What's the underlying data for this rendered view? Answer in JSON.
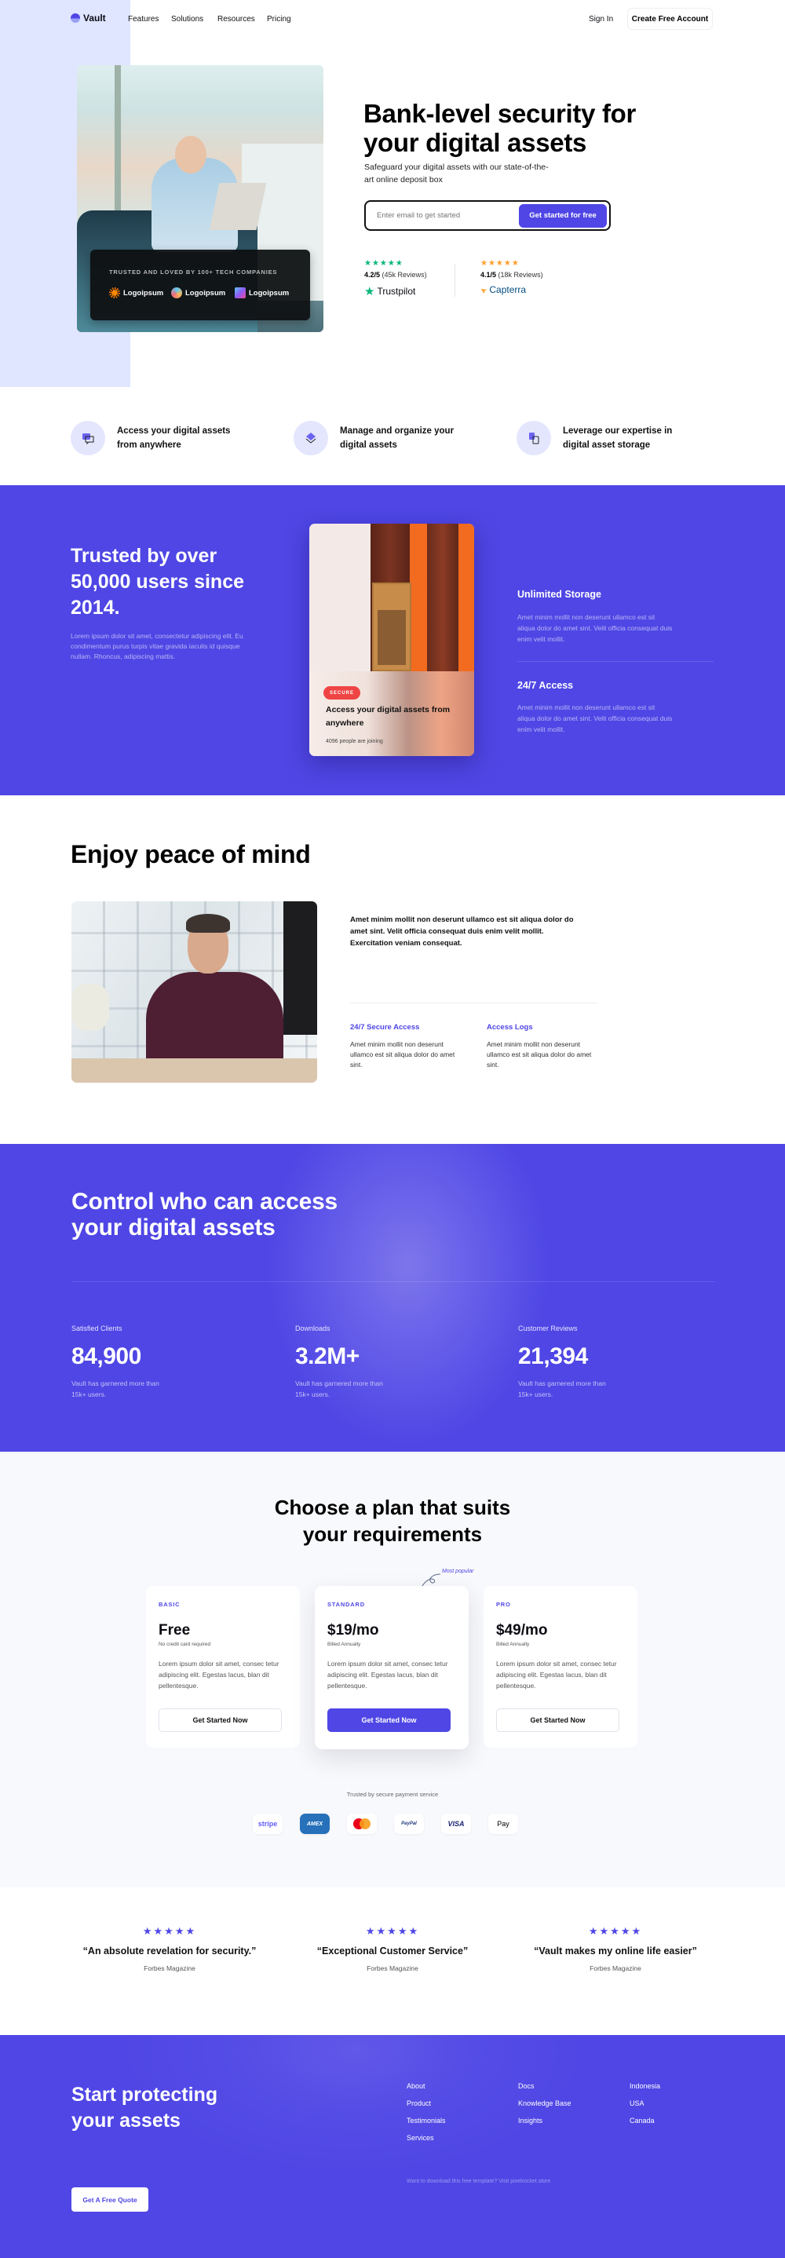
{
  "nav": {
    "brand": "Vault",
    "links": [
      "Features",
      "Solutions",
      "Resources",
      "Pricing"
    ],
    "sign_in": "Sign In",
    "cta": "Create Free Account"
  },
  "hero": {
    "title": "Bank-level security for your digital assets",
    "subtitle": "Safeguard your digital assets with our state-of-the-art online deposit box",
    "email_placeholder": "Enter email to get started",
    "email_button": "Get started for free",
    "trust_title": "TRUSTED AND LOVED BY 100+ TECH COMPANIES",
    "trust_logos": [
      "Logoipsum",
      "Logoipsum",
      "Logoipsum"
    ],
    "ratings": [
      {
        "stars": "★★★★★",
        "score": "4.2/5",
        "reviews": "(45k Reviews)",
        "brand": "Trustpilot",
        "brand_icon": "★",
        "color": "#00b67a"
      },
      {
        "stars": "★★★★★",
        "score": "4.1/5",
        "reviews": "(18k Reviews)",
        "brand": "Capterra",
        "brand_icon": "➤",
        "color": "#ff9d28"
      }
    ]
  },
  "features": [
    {
      "icon": "chat-icon",
      "glyph": "💬",
      "text": "Access your digital assets from anywhere"
    },
    {
      "icon": "layers-icon",
      "glyph": "◈",
      "text": "Manage and organize your digital assets"
    },
    {
      "icon": "sync-icon",
      "glyph": "⇄",
      "text": "Leverage our expertise in digital asset storage"
    }
  ],
  "trusted": {
    "title": "Trusted by over 50,000 users since 2014.",
    "body": "Lorem ipsum dolor sit amet, consectetur adipiscing elit. Eu condimentum purus turpis vitae gravida iaculis id quisque nullam. Rhoncus, adipiscing mattis.",
    "card": {
      "badge": "SECURE",
      "title": "Access your digital assets from anywhere",
      "sub": "4096 people are joining"
    },
    "items": [
      {
        "title": "Unlimited Storage",
        "body": "Amet minim mollit non deserunt ullamco est sit aliqua dolor do amet sint. Velit officia consequat duis enim velit mollit."
      },
      {
        "title": "24/7 Access",
        "body": "Amet minim mollit non deserunt ullamco est sit aliqua dolor do amet sint. Velit officia consequat duis enim velit mollit."
      }
    ]
  },
  "peace": {
    "title": "Enjoy peace of mind",
    "lead": "Amet minim mollit non deserunt ullamco est sit aliqua dolor do amet sint. Velit officia consequat duis enim velit mollit. Exercitation veniam consequat.",
    "cols": [
      {
        "title": "24/7 Secure Access",
        "body": "Amet minim mollit non deserunt ullamco est sit aliqua dolor do amet sint."
      },
      {
        "title": "Access Logs",
        "body": "Amet minim mollit non deserunt ullamco est sit aliqua dolor do amet sint."
      }
    ]
  },
  "control": {
    "title_l1": "Control who can access",
    "title_l2": "your digital assets",
    "stats": [
      {
        "label": "Satisfied Clients",
        "value": "84,900",
        "desc": "Vault has garnered more than 15k+ users."
      },
      {
        "label": "Downloads",
        "value": "3.2M+",
        "desc": "Vault has garnered more than 15k+ users."
      },
      {
        "label": "Customer Reviews",
        "value": "21,394",
        "desc": "Vault has garnered more than 15k+ users."
      }
    ]
  },
  "pricing": {
    "title_l1": "Choose a plan that suits",
    "title_l2": "your requirements",
    "most_popular": "Most popular",
    "plans": [
      {
        "tier": "BASIC",
        "price": "Free",
        "note": "No credit card required",
        "desc": "Lorem ipsum dolor sit amet, consec tetur adipiscing elit. Egestas lacus, blan dit pellentesque.",
        "button": "Get Started Now"
      },
      {
        "tier": "STANDARD",
        "price": "$19/mo",
        "note": "Billed Annually",
        "desc": "Lorem ipsum dolor sit amet, consec tetur adipiscing elit. Egestas lacus, blan dit pellentesque.",
        "button": "Get Started Now"
      },
      {
        "tier": "PRO",
        "price": "$49/mo",
        "note": "Billed Annually",
        "desc": "Lorem ipsum dolor sit amet, consec tetur adipiscing elit. Egestas lacus, blan dit pellentesque.",
        "button": "Get Started Now"
      }
    ],
    "payment_label": "Trusted by secure payment service",
    "payments": [
      "stripe",
      "AMEX",
      "",
      "PayPal",
      "VISA",
      " Pay"
    ]
  },
  "testimonials": [
    {
      "stars": "★★★★★",
      "quote": "“An absolute revelation for security.”",
      "source": "Forbes Magazine"
    },
    {
      "stars": "★★★★★",
      "quote": "“Exceptional Customer Service”",
      "source": "Forbes Magazine"
    },
    {
      "stars": "★★★★★",
      "quote": "“Vault makes my online life easier”",
      "source": "Forbes Magazine"
    }
  ],
  "footer": {
    "title": "Start protecting your assets",
    "cta": "Get A Free Quote",
    "cols": [
      [
        "About",
        "Product",
        "Testimonials",
        "Services"
      ],
      [
        "Docs",
        "Knowledge Base",
        "Insights"
      ],
      [
        "Indonesia",
        "USA",
        "Canada"
      ]
    ],
    "note": "Want to download this free template? Visit pixelrocket.store"
  }
}
